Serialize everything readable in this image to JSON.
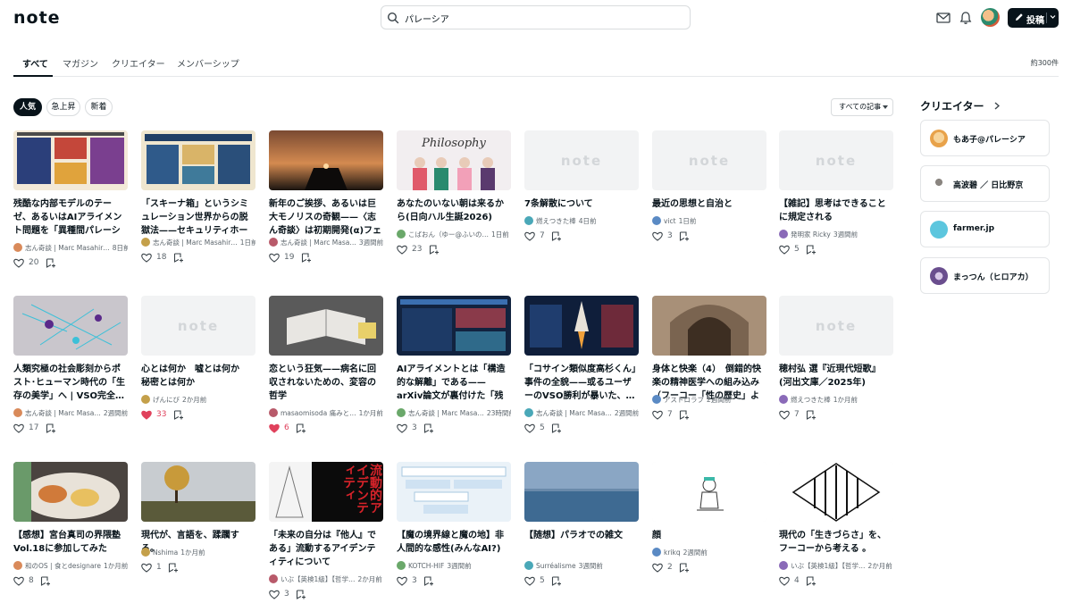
{
  "header": {
    "logo": "note",
    "search_value": "パレーシア",
    "post_label": "投稿"
  },
  "tabs": [
    {
      "label": "すべて",
      "active": true
    },
    {
      "label": "マガジン"
    },
    {
      "label": "クリエイター"
    },
    {
      "label": "メンバーシップ"
    }
  ],
  "result_count": "約300件",
  "filters": [
    "人気",
    "急上昇",
    "新着"
  ],
  "article_filter": "すべての記事",
  "placeholder_logo": "note",
  "cards": [
    {
      "title": "残酷な内部モデルのテーゼ、あるいはAIアライメント問題を「異種間パレーシア」…",
      "author": "志ん奇談 | Marc Masahir…",
      "time": "8日前",
      "likes": "20",
      "liked": false,
      "thumb": "infographic"
    },
    {
      "title": "「スキーナ箱」というシミュレーション世界からの脱獄法——セキュリティホールと…",
      "author": "志ん奇談 | Marc Masahir…",
      "time": "1日前",
      "likes": "18",
      "liked": false,
      "thumb": "infographic2"
    },
    {
      "title": "新年のご挨拶、あるいは巨大モノリスの奇観——〈志ん奇談〉は初期開発(α)フェイ…",
      "author": "志ん奇談 | Marc Masa…",
      "time": "3週間前",
      "likes": "19",
      "liked": false,
      "thumb": "monolith"
    },
    {
      "title": "あなたのいない朝は来るから(日向ハル生誕2026)",
      "author": "こばおん（ゆー@ふいの…",
      "time": "1日前",
      "likes": "23",
      "liked": false,
      "thumb": "idols"
    },
    {
      "title": "7条解散について",
      "author": "燃えつきた棒",
      "time": "4日前",
      "likes": "7",
      "liked": false,
      "thumb": "placeholder"
    },
    {
      "title": "最近の思想と自治と",
      "author": "vict",
      "time": "1日前",
      "likes": "3",
      "liked": false,
      "thumb": "placeholder"
    },
    {
      "title": "【雑記】思考はできることに規定される",
      "author": "発明家 Ricky",
      "time": "3週間前",
      "likes": "5",
      "liked": false,
      "thumb": "placeholder"
    },
    {
      "title": "人類究極の社会彫刻からポスト･ヒューマン時代の「生存の美学」へ | VSO完全…",
      "author": "志ん奇談 | Marc Masa…",
      "time": "2週間前",
      "likes": "17",
      "liked": false,
      "thumb": "network"
    },
    {
      "title": "心とは何か　嘘とは何か　秘密とは何か",
      "author": "げんにび",
      "time": "2か月前",
      "likes": "33",
      "liked": true,
      "thumb": "placeholder"
    },
    {
      "title": "恋という狂気——病名に回収されないための、変容の哲学",
      "author": "masaomisoda 痛みと…",
      "time": "1か月前",
      "likes": "6",
      "liked": true,
      "thumb": "book"
    },
    {
      "title": "AIアライメントとは「構造的な解離」である——arXiv論文が裏付けた「残酷な内…",
      "author": "志ん奇談 | Marc Masa…",
      "time": "23時間前",
      "likes": "3",
      "liked": false,
      "thumb": "infodark"
    },
    {
      "title": "「コサイン類似度高杉くん」事件の全貌——或るユーザーのVSO勝利が暴いた、…",
      "author": "志ん奇談 | Marc Masa…",
      "time": "2週間前",
      "likes": "5",
      "liked": false,
      "thumb": "rocket"
    },
    {
      "title": "身体と快楽（4）　倒錯的快楽の精神医学への組み込み（フーコー「性の歴史」より）",
      "author": "アストロラブ",
      "time": "2週間前",
      "likes": "7",
      "liked": false,
      "thumb": "cathedral"
    },
    {
      "title": "穂村弘 選『近現代短歌』(河出文庫／2025年)",
      "author": "燃えつきた棒",
      "time": "1か月前",
      "likes": "7",
      "liked": false,
      "thumb": "placeholder"
    },
    {
      "title": "【感想】宮台真司の界隈塾Vol.18に参加してみた",
      "author": "和のOS | 食とdesignare",
      "time": "1か月前",
      "likes": "8",
      "liked": false,
      "thumb": "food"
    },
    {
      "title": "現代が、言語を、蹂躙する。",
      "author": "Nshima",
      "time": "1か月前",
      "likes": "1",
      "liked": false,
      "thumb": "tree"
    },
    {
      "title": "「未来の自分は『他人』である」流動するアイデンティティについて",
      "author": "いぶ【英検1級】【哲学…",
      "time": "2か月前",
      "likes": "3",
      "liked": false,
      "thumb": "identity",
      "thumb_text": "流動的アイデンティティ"
    },
    {
      "title": "【魔の境界線と魔の地】非人間的な感性(みんなAI?)",
      "author": "KOTCH-HIF",
      "time": "3週間前",
      "likes": "3",
      "liked": false,
      "thumb": "textboxes"
    },
    {
      "title": "【随想】パラオでの雑文",
      "author": "Surréalisme",
      "time": "3週間前",
      "likes": "5",
      "liked": false,
      "thumb": "sea"
    },
    {
      "title": "顔",
      "author": "krikq",
      "time": "2週間前",
      "likes": "2",
      "liked": false,
      "thumb": "doodle"
    },
    {
      "title": "現代の「生きづらさ」を、　フーコーから考える 。",
      "author": "いぶ【英検1級】【哲学…",
      "time": "2か月前",
      "likes": "4",
      "liked": false,
      "thumb": "prison"
    }
  ],
  "creators_heading": "クリエイター",
  "creators": [
    {
      "name": "もあ子@パレーシア",
      "color": "#e8a24a"
    },
    {
      "name": "高波碧 ／ 日比野京",
      "color": "#cfc9c2"
    },
    {
      "name": "farmer.jp",
      "color": "#5cc6de"
    },
    {
      "name": "まっつん（ヒロアカ）",
      "color": "#6a4e8e"
    }
  ],
  "colors": {
    "accent": "#08131a",
    "like": "#e0415c"
  }
}
